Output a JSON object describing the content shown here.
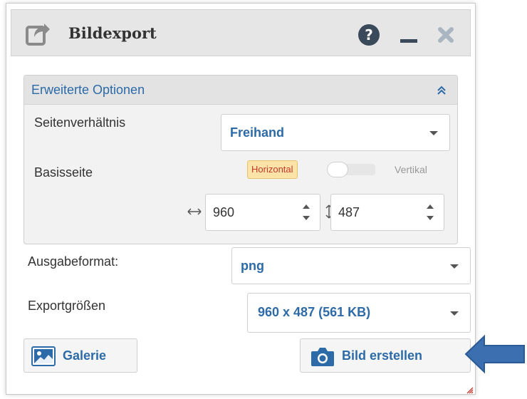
{
  "window": {
    "title": "Bildexport",
    "icons": {
      "title": "share-export-icon",
      "help": "help-icon",
      "minimize": "minimize-icon",
      "close": "close-icon"
    }
  },
  "advanced": {
    "title": "Erweiterte Optionen",
    "collapse_icon": "chevron-double-up-icon",
    "aspect_label": "Seitenverhältnis",
    "aspect_value": "Freihand",
    "base_label": "Basisseite",
    "horizontal_label": "Horizontal",
    "vertical_label": "Vertikal",
    "width_value": "960",
    "height_value": "487"
  },
  "output": {
    "format_label": "Ausgabeformat:",
    "format_value": "png",
    "size_label": "Exportgrößen",
    "size_value": "960 x 487 (561 KB)"
  },
  "buttons": {
    "gallery": "Galerie",
    "create": "Bild erstellen"
  },
  "colors": {
    "accent": "#2c6aa8",
    "annotation_arrow": "#3b6fb0"
  }
}
